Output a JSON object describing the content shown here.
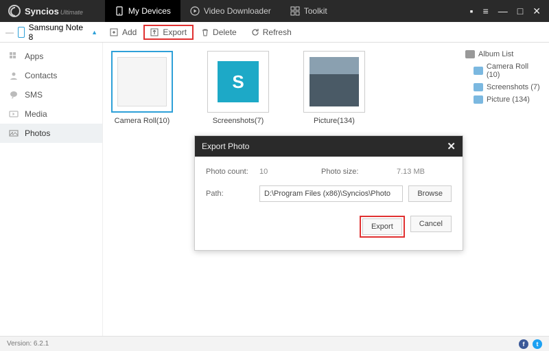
{
  "app": {
    "name": "Syncios",
    "edition": "Ultimate"
  },
  "topTabs": [
    {
      "label": "My Devices"
    },
    {
      "label": "Video Downloader"
    },
    {
      "label": "Toolkit"
    }
  ],
  "device": {
    "name": "Samsung Note 8"
  },
  "toolbar": {
    "add": "Add",
    "export": "Export",
    "delete": "Delete",
    "refresh": "Refresh"
  },
  "sidebar": {
    "items": [
      {
        "label": "Apps"
      },
      {
        "label": "Contacts"
      },
      {
        "label": "SMS"
      },
      {
        "label": "Media"
      },
      {
        "label": "Photos"
      }
    ]
  },
  "albums": [
    {
      "label": "Camera Roll(10)"
    },
    {
      "label": "Screenshots(7)"
    },
    {
      "label": "Picture(134)"
    }
  ],
  "rightList": {
    "header": "Album List",
    "items": [
      {
        "label": "Camera Roll (10)"
      },
      {
        "label": "Screenshots (7)"
      },
      {
        "label": "Picture (134)"
      }
    ]
  },
  "modal": {
    "title": "Export Photo",
    "countLabel": "Photo count:",
    "countValue": "10",
    "sizeLabel": "Photo size:",
    "sizeValue": "7.13 MB",
    "pathLabel": "Path:",
    "pathValue": "D:\\Program Files (x86)\\Syncios\\Photo",
    "browse": "Browse",
    "export": "Export",
    "cancel": "Cancel"
  },
  "footer": {
    "version": "Version: 6.2.1"
  }
}
